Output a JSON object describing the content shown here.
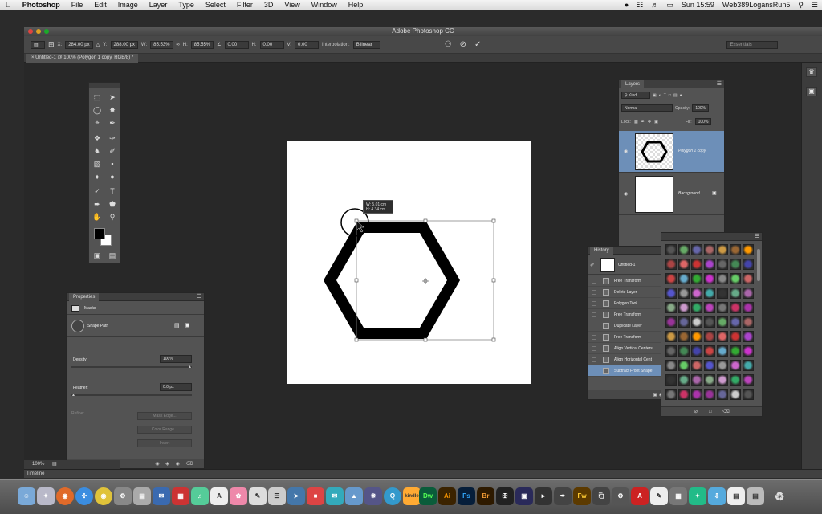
{
  "menubar": {
    "app": "Photoshop",
    "items": [
      "File",
      "Edit",
      "Image",
      "Layer",
      "Type",
      "Select",
      "Filter",
      "3D",
      "View",
      "Window",
      "Help"
    ],
    "time": "Sun 15:59",
    "user": "Web389LogansRun5"
  },
  "window": {
    "title": "Adobe Photoshop CC"
  },
  "options": {
    "x_label": "X:",
    "x_value": "284.00 px",
    "y_label": "Y:",
    "y_value": "288.00 px",
    "w_label": "W:",
    "w_value": "85.53%",
    "h_label": "H:",
    "h_value": "85.55%",
    "angle_value": "0.00",
    "hskew_label": "H:",
    "hskew_value": "0.00",
    "vskew_label": "V:",
    "vskew_value": "0.00",
    "interp_label": "Interpolation:",
    "interp_value": "Bilinear",
    "workspace": "Essentials"
  },
  "doc_tab": "Untitled-1 @ 100% (Polygon 1 copy, RGB/8) *",
  "tooltip": {
    "w": "W: 5.01 cm",
    "h": "H: 4.34 cm"
  },
  "layers": {
    "title": "Layers",
    "kind": "Kind",
    "blend": "Normal",
    "opacity_label": "Opacity:",
    "opacity": "100%",
    "lock_label": "Lock:",
    "fill_label": "Fill:",
    "fill": "100%",
    "items": [
      {
        "name": "Polygon 1 copy",
        "selected": true
      },
      {
        "name": "Background",
        "selected": false
      }
    ]
  },
  "history": {
    "title": "History",
    "snapshot": "Untitled-1",
    "items": [
      "Free Transform",
      "Delete Layer",
      "Polygon Tool",
      "Free Transform",
      "Duplicate Layer",
      "Free Transform",
      "Align Vertical Centers",
      "Align Horizontal Cent",
      "Subtract Front Shape"
    ]
  },
  "properties": {
    "title": "Properties",
    "section": "Masks",
    "shape": "Shape Path",
    "density_label": "Density:",
    "density": "100%",
    "feather_label": "Feather:",
    "feather": "0.0 px",
    "refine": "Refine:",
    "btn_mask_edge": "Mask Edge...",
    "btn_color_range": "Color Range...",
    "btn_invert": "Invert"
  },
  "status": {
    "zoom": "100%"
  },
  "timeline": "Timeline",
  "dock_apps": [
    "Dw",
    "Ai",
    "Ps",
    "Br",
    "Fw"
  ],
  "colors": {
    "accent": "#6d8fb8",
    "panel": "#535353",
    "workspace": "#282828"
  }
}
